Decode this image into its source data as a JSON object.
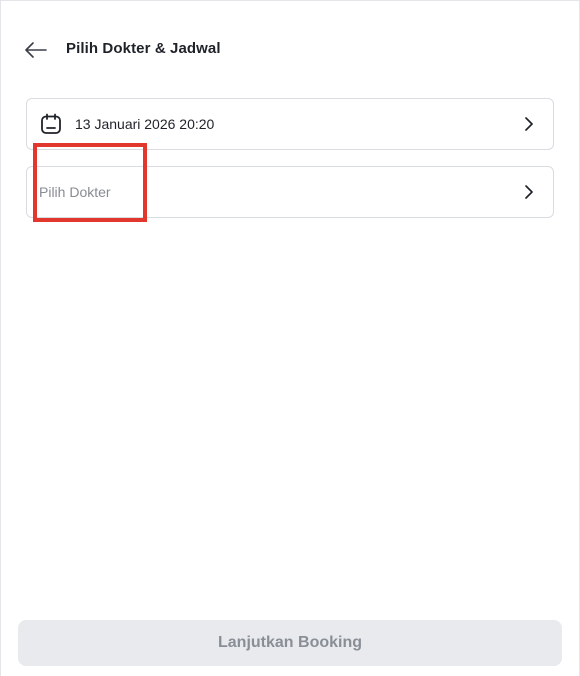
{
  "header": {
    "title": "Pilih Dokter & Jadwal",
    "back_icon": "arrow-left-icon"
  },
  "schedule_field": {
    "value": "13 Januari 2026 20:20",
    "icon": "calendar-icon"
  },
  "doctor_field": {
    "placeholder": "Pilih Dokter"
  },
  "footer": {
    "continue_label": "Lanjutkan Booking",
    "enabled": false
  },
  "colors": {
    "text_primary": "#1f2329",
    "text_placeholder": "#878b93",
    "border": "#d9dce1",
    "highlight": "#e2372d",
    "button_disabled_bg": "#e8eaed",
    "button_disabled_text": "#8a8f97"
  }
}
